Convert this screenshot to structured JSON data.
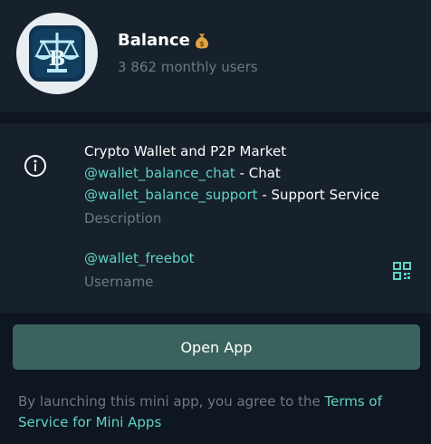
{
  "header": {
    "title": "Balance",
    "title_emoji_icon": "money-bag-icon",
    "subtitle": "3 862 monthly users",
    "avatar_icon": "scales-logo-icon"
  },
  "info": {
    "description_lines": [
      {
        "text": "Crypto Wallet and P2P Market"
      },
      {
        "link": "@wallet_balance_chat",
        "text": " - Chat"
      },
      {
        "link": "@wallet_balance_support",
        "text": " - Support Service"
      }
    ],
    "description_label": "Description",
    "username": "@wallet_freebot",
    "username_label": "Username",
    "info_icon": "info-icon",
    "qr_icon": "qr-code-icon"
  },
  "action": {
    "open_label": "Open App"
  },
  "footer": {
    "text": "By launching this mini app, you agree to the ",
    "link_text": "Terms of Service for Mini Apps"
  },
  "colors": {
    "background": "#17212b",
    "separator": "#0e1621",
    "link": "#5fd3c4",
    "muted": "#6d7883",
    "button": "#3b635d"
  }
}
